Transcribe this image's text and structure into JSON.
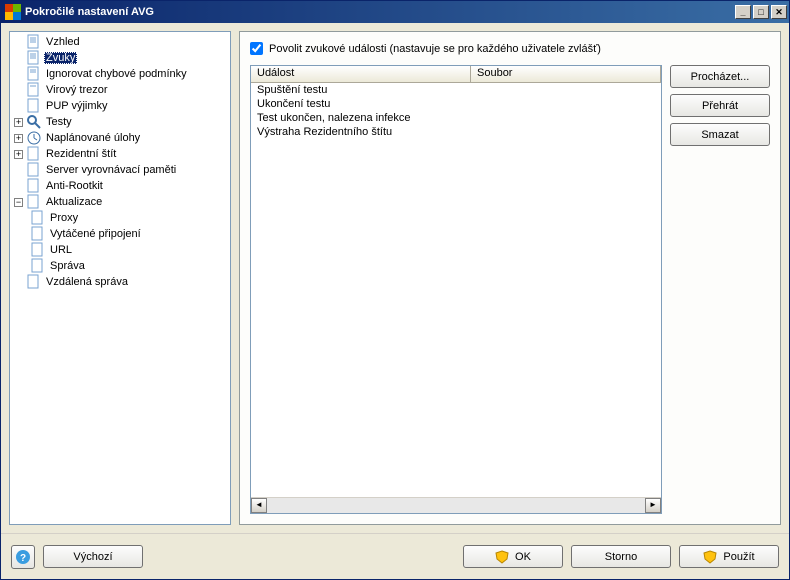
{
  "window": {
    "title": "Pokročilé nastavení AVG"
  },
  "tree": {
    "vzhled": "Vzhled",
    "zvuky": "Zvuky",
    "ignorovat": "Ignorovat chybové podmínky",
    "virovy_trezor": "Virový trezor",
    "pup": "PUP výjimky",
    "testy": "Testy",
    "naplanovane": "Naplánované úlohy",
    "rezidentni": "Rezidentní štít",
    "server_vyr": "Server vyrovnávací paměti",
    "anti_rootkit": "Anti-Rootkit",
    "aktualizace": "Aktualizace",
    "proxy": "Proxy",
    "vytacene": "Vytáčené připojení",
    "url": "URL",
    "sprava": "Správa",
    "vzdalena": "Vzdálená správa"
  },
  "panel": {
    "checkbox_label": "Povolit zvukové události (nastavuje se pro každého uživatele zvlášť)",
    "col_event": "Událost",
    "col_file": "Soubor",
    "events": {
      "e0": "Spuštění testu",
      "e1": "Ukončení testu",
      "e2": "Test ukončen, nalezena infekce",
      "e3": "Výstraha Rezidentního štítu"
    },
    "btn_browse": "Procházet...",
    "btn_play": "Přehrát",
    "btn_delete": "Smazat"
  },
  "footer": {
    "default": "Výchozí",
    "ok": "OK",
    "cancel": "Storno",
    "apply": "Použít"
  }
}
